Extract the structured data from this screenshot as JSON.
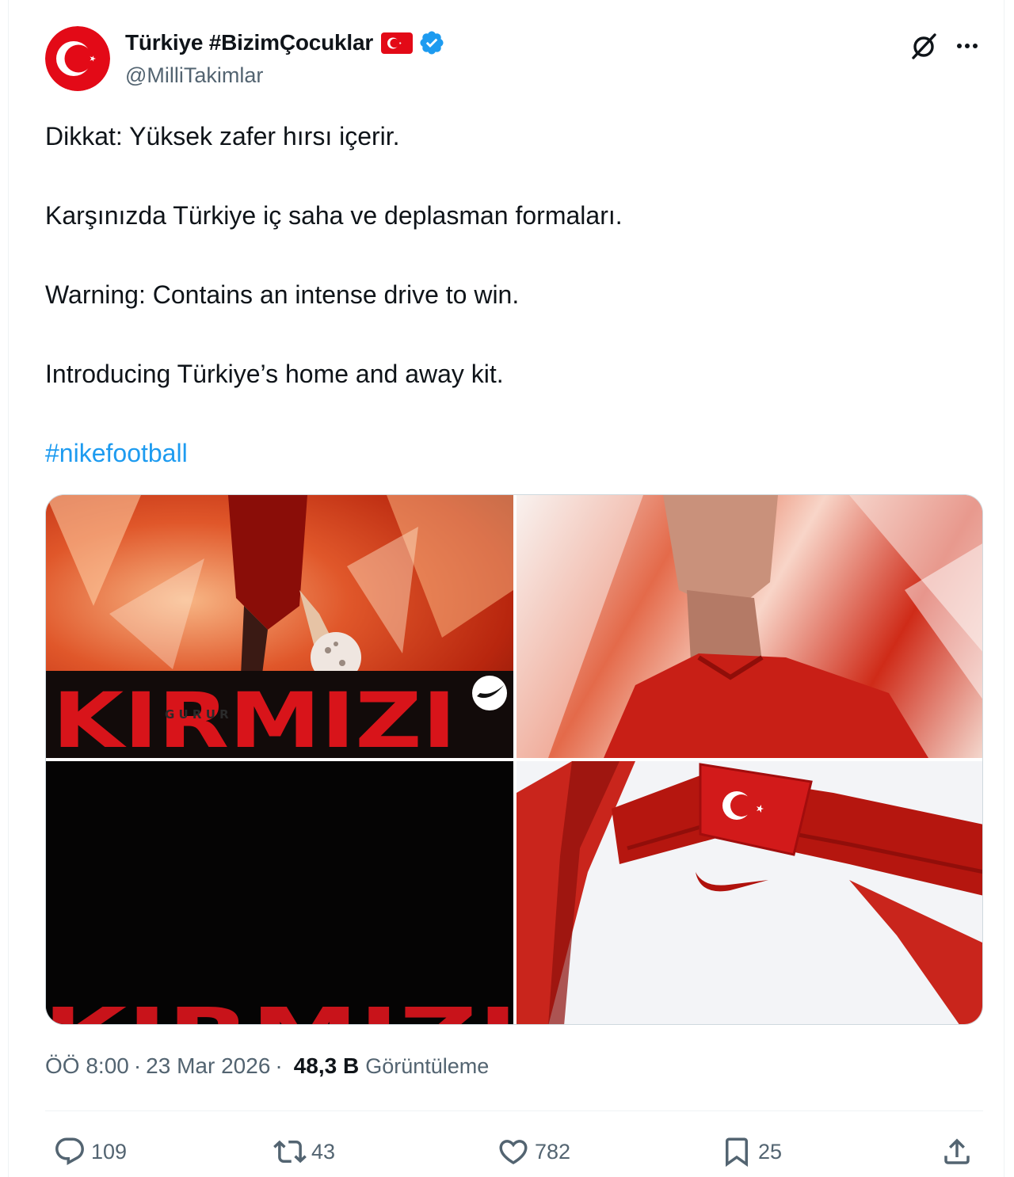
{
  "author": {
    "display_name": "Türkiye #BizimÇocuklar",
    "handle": "@MilliTakimlar",
    "verified": true,
    "flag_emoji": "turkey-flag"
  },
  "tweet": {
    "paragraphs": [
      "Dikkat: Yüksek zafer hırsı içerir.",
      "Karşınızda Türkiye iç saha ve deplasman formaları.",
      "Warning: Contains an intense drive to win.",
      "Introducing Türkiye’s home and away kit."
    ],
    "hashtag": "#nikefootball"
  },
  "media": {
    "image1_text": "KIRMIZI",
    "image1_subtext": "G U R U R",
    "image3_text": "KIRMIZI"
  },
  "meta": {
    "time": "ÖÖ 8:00",
    "date": "23 Mar 2026",
    "views_count": "48,3 B",
    "views_label": "Görüntüleme"
  },
  "actions": {
    "replies": "109",
    "reposts": "43",
    "likes": "782",
    "bookmarks": "25"
  },
  "colors": {
    "accent": "#1d9bf0",
    "secondary_text": "#536471",
    "primary_text": "#0f1419",
    "turkey_red": "#e30a17"
  }
}
